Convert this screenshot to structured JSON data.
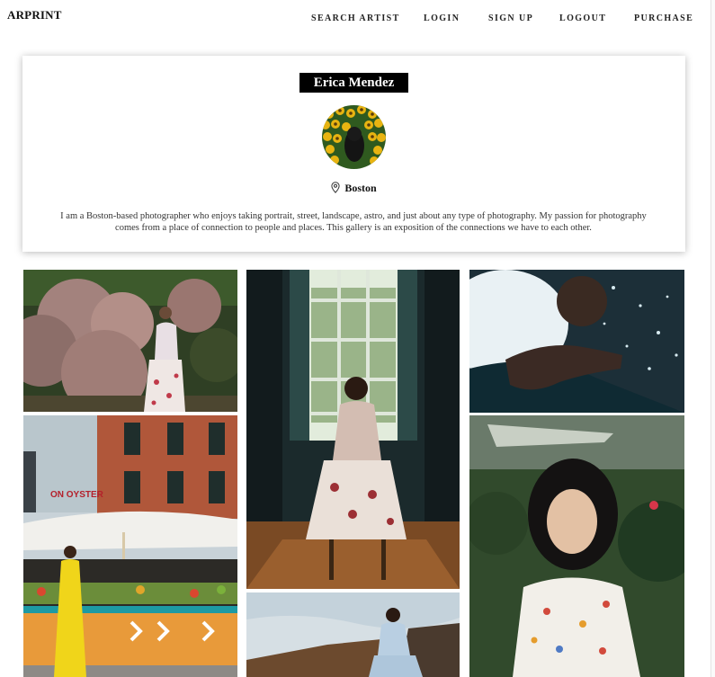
{
  "header": {
    "brand": "ARPRINT",
    "nav": [
      "SEARCH ARTIST",
      "LOGIN",
      "SIGN UP",
      "LOGOUT",
      "PURCHASE"
    ]
  },
  "profile": {
    "name": "Erica Mendez",
    "location": "Boston",
    "bio": "I am a Boston-based photographer who enjoys taking portrait, street, landscape, astro, and just about any type of photography. My passion for photography comes from a place of connection to people and places. This gallery is an exposition of the connections we have to each other."
  },
  "gallery": {
    "photos": [
      "photo-woman-smoke-tree",
      "photo-woman-chair-window",
      "photo-hand-water-splash",
      "photo-oyster-house-market",
      "photo-woman-on-rocks",
      "photo-woman-floral-portrait"
    ],
    "sign_text": "ON OYSTER"
  },
  "colors": {
    "brand_bg": "#000000",
    "brand_text": "#ffffff",
    "nav_text": "#222222"
  }
}
